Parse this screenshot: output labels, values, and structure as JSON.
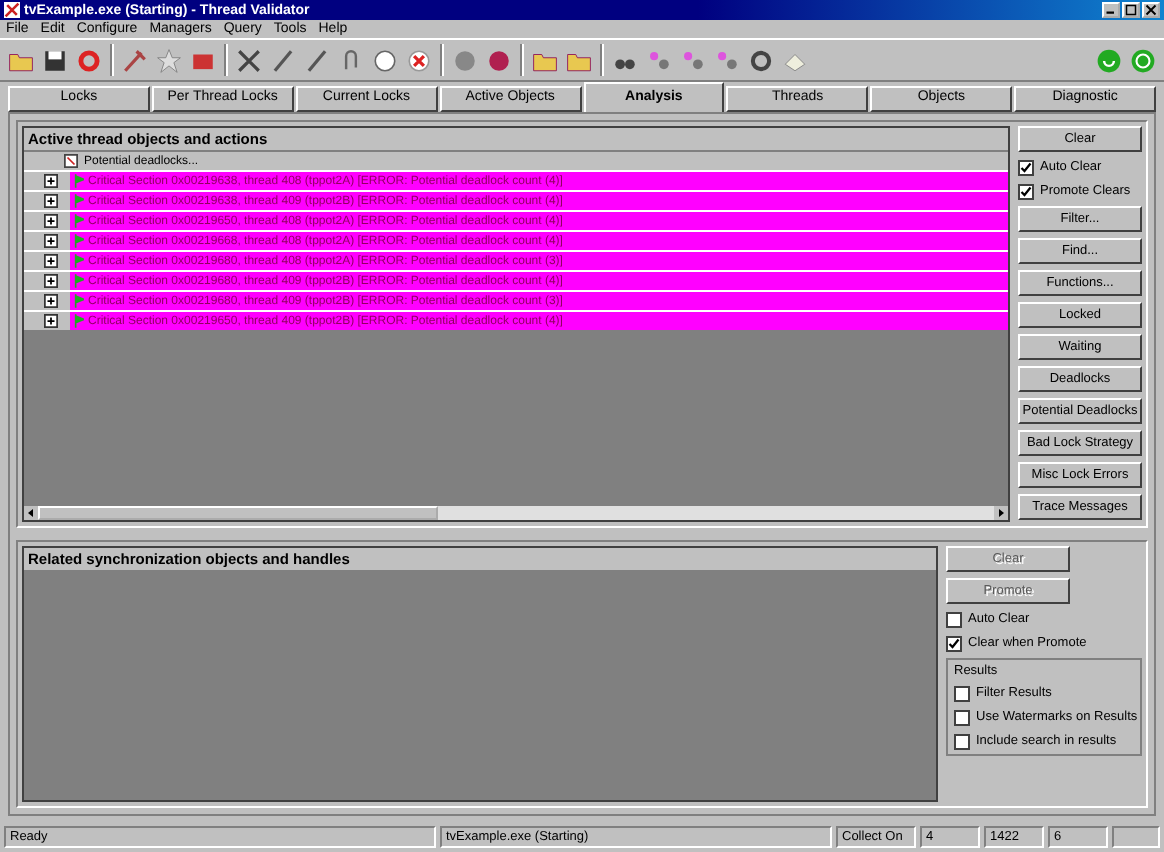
{
  "window": {
    "title": "tvExample.exe (Starting) - Thread Validator"
  },
  "menu": [
    "File",
    "Edit",
    "Configure",
    "Managers",
    "Query",
    "Tools",
    "Help"
  ],
  "tabs": [
    {
      "label": "Locks",
      "selected": false
    },
    {
      "label": "Per Thread Locks",
      "selected": false
    },
    {
      "label": "Current Locks",
      "selected": false
    },
    {
      "label": "Active Objects",
      "selected": false
    },
    {
      "label": "Analysis",
      "selected": true
    },
    {
      "label": "Threads",
      "selected": false
    },
    {
      "label": "Objects",
      "selected": false
    },
    {
      "label": "Diagnostic",
      "selected": false
    }
  ],
  "top_panel": {
    "title": "Active thread objects and actions",
    "root": "Potential deadlocks...",
    "rows": [
      "Critical Section 0x00219638, thread 408 (tppot2A) [ERROR: Potential deadlock count (4)]",
      "Critical Section 0x00219638, thread 409 (tppot2B) [ERROR: Potential deadlock count (4)]",
      "Critical Section 0x00219650, thread 408 (tppot2A) [ERROR: Potential deadlock count (4)]",
      "Critical Section 0x00219668, thread 408 (tppot2A) [ERROR: Potential deadlock count (4)]",
      "Critical Section 0x00219680, thread 408 (tppot2A) [ERROR: Potential deadlock count (3)]",
      "Critical Section 0x00219680, thread 409 (tppot2B) [ERROR: Potential deadlock count (4)]",
      "Critical Section 0x00219680, thread 409 (tppot2B) [ERROR: Potential deadlock count (3)]",
      "Critical Section 0x00219650, thread 409 (tppot2B) [ERROR: Potential deadlock count (4)]"
    ],
    "controls": [
      {
        "kind": "button",
        "label": "Clear"
      },
      {
        "kind": "checkbox",
        "label": "Auto Clear",
        "checked": true
      },
      {
        "kind": "checkbox",
        "label": "Promote Clears",
        "checked": true
      },
      {
        "kind": "button",
        "label": "Filter..."
      },
      {
        "kind": "button",
        "label": "Find..."
      },
      {
        "kind": "button",
        "label": "Functions..."
      },
      {
        "kind": "button",
        "label": "Locked"
      },
      {
        "kind": "button",
        "label": "Waiting"
      },
      {
        "kind": "button",
        "label": "Deadlocks"
      },
      {
        "kind": "button",
        "label": "Potential Deadlocks"
      },
      {
        "kind": "button",
        "label": "Bad Lock Strategy"
      },
      {
        "kind": "button",
        "label": "Misc Lock Errors"
      },
      {
        "kind": "button",
        "label": "Trace Messages"
      }
    ]
  },
  "bottom_panel": {
    "title": "Related synchronization objects and handles",
    "controls": [
      {
        "kind": "button",
        "label": "Clear",
        "disabled": true
      },
      {
        "kind": "button",
        "label": "Promote",
        "disabled": true
      },
      {
        "kind": "checkbox",
        "label": "Auto Clear",
        "checked": false
      },
      {
        "kind": "checkbox",
        "label": "Clear when Promote",
        "checked": true
      }
    ],
    "results": {
      "title": "Results",
      "options": [
        {
          "label": "Filter Results",
          "checked": false
        },
        {
          "label": "Use Watermarks on Results",
          "checked": false
        },
        {
          "label": "Include search in results",
          "checked": false
        }
      ]
    }
  },
  "status_bar": [
    "Ready",
    "tvExample.exe (Starting)",
    "Collect On",
    "4",
    "1422",
    "6"
  ]
}
